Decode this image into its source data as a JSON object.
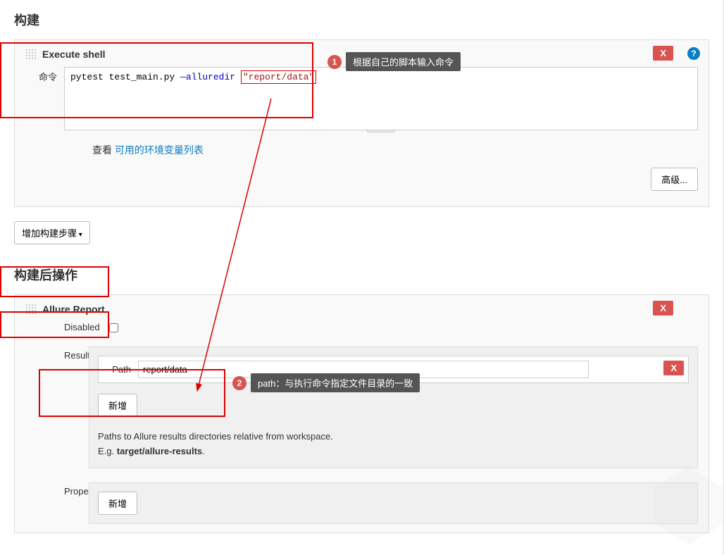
{
  "build": {
    "title": "构建",
    "steps": {
      "execute_shell": {
        "title": "Execute shell",
        "command_label": "命令",
        "command_prefix": "pytest test_main.py ",
        "command_flag": "—alluredir ",
        "command_arg": "\"report/data\"",
        "env_prefix": "查看 ",
        "env_link": "可用的环境变量列表",
        "advanced_btn": "高级...",
        "delete_text": "X"
      }
    },
    "add_step_btn": "增加构建步骤"
  },
  "post_build": {
    "title": "构建后操作",
    "allure": {
      "title": "Allure Report",
      "disabled_label": "Disabled",
      "disabled_checked": false,
      "results": {
        "label": "Results:",
        "path_label": "Path",
        "path_value": "report/data",
        "add_btn": "新增",
        "delete_text": "X",
        "help_line1": "Paths to Allure results directories relative from workspace.",
        "help_line2_prefix": "E.g. ",
        "help_line2_bold": "target/allure-results",
        "help_line2_suffix": "."
      },
      "properties": {
        "label": "Properties",
        "add_btn": "新增"
      },
      "delete_text": "X"
    }
  },
  "annotations": {
    "a1": {
      "num": "1",
      "text": "根据自己的脚本输入命令"
    },
    "a2": {
      "num": "2",
      "text": "path：与执行命令指定文件目录的一致"
    }
  },
  "help_icon": "?"
}
